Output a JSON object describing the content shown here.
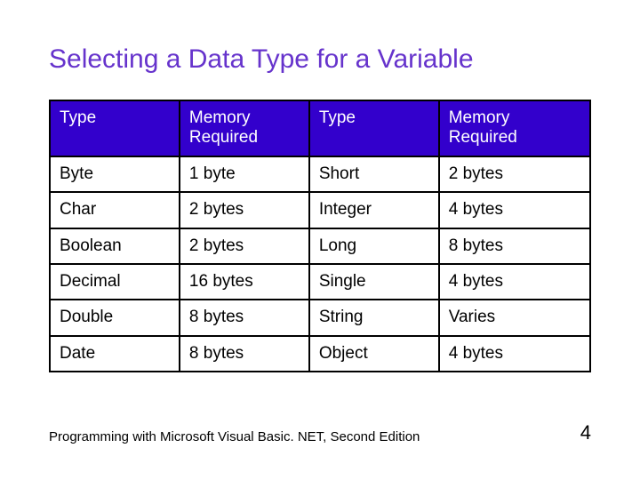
{
  "title": "Selecting a Data Type for a Variable",
  "header": {
    "col1": "Type",
    "col2": "Memory Required",
    "col3": "Type",
    "col4": "Memory Required"
  },
  "rows": [
    {
      "c1": "Byte",
      "c2": "1 byte",
      "c3": "Short",
      "c4": "2 bytes"
    },
    {
      "c1": "Char",
      "c2": "2 bytes",
      "c3": "Integer",
      "c4": "4 bytes"
    },
    {
      "c1": "Boolean",
      "c2": "2 bytes",
      "c3": "Long",
      "c4": "8 bytes"
    },
    {
      "c1": "Decimal",
      "c2": "16 bytes",
      "c3": "Single",
      "c4": "4 bytes"
    },
    {
      "c1": "Double",
      "c2": "8 bytes",
      "c3": "String",
      "c4": "Varies"
    },
    {
      "c1": "Date",
      "c2": "8 bytes",
      "c3": "Object",
      "c4": "4 bytes"
    }
  ],
  "footer": {
    "text": "Programming with Microsoft Visual Basic. NET, Second Edition",
    "page": "4"
  },
  "chart_data": {
    "type": "table",
    "title": "Selecting a Data Type for a Variable",
    "columns": [
      "Type",
      "Memory Required",
      "Type",
      "Memory Required"
    ],
    "rows": [
      [
        "Byte",
        "1 byte",
        "Short",
        "2 bytes"
      ],
      [
        "Char",
        "2 bytes",
        "Integer",
        "4 bytes"
      ],
      [
        "Boolean",
        "2 bytes",
        "Long",
        "8 bytes"
      ],
      [
        "Decimal",
        "16 bytes",
        "Single",
        "4 bytes"
      ],
      [
        "Double",
        "8 bytes",
        "String",
        "Varies"
      ],
      [
        "Date",
        "8 bytes",
        "Object",
        "4 bytes"
      ]
    ]
  }
}
